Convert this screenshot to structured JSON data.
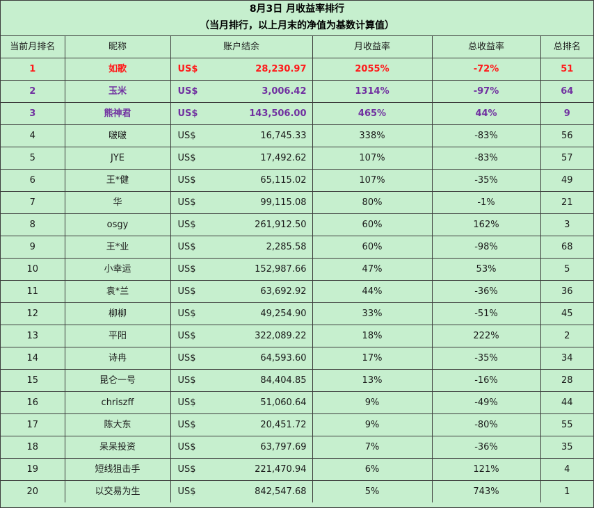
{
  "title": {
    "line1": "8月3日 月收益率排行",
    "line2": "（当月排行，以上月末的净值为基数计算值）"
  },
  "headers": [
    "当前月排名",
    "昵称",
    "账户结余",
    "月收益率",
    "总收益率",
    "总排名"
  ],
  "currency": "US$",
  "rows": [
    {
      "rank": "1",
      "name": "如歌",
      "balance": "28,230.97",
      "monthly": "2055%",
      "total": "-72%",
      "overall": "51"
    },
    {
      "rank": "2",
      "name": "玉米",
      "balance": "3,006.42",
      "monthly": "1314%",
      "total": "-97%",
      "overall": "64"
    },
    {
      "rank": "3",
      "name": "熊神君",
      "balance": "143,506.00",
      "monthly": "465%",
      "total": "44%",
      "overall": "9"
    },
    {
      "rank": "4",
      "name": "啵啵",
      "balance": "16,745.33",
      "monthly": "338%",
      "total": "-83%",
      "overall": "56"
    },
    {
      "rank": "5",
      "name": "JYE",
      "balance": "17,492.62",
      "monthly": "107%",
      "total": "-83%",
      "overall": "57"
    },
    {
      "rank": "6",
      "name": "王*健",
      "balance": "65,115.02",
      "monthly": "107%",
      "total": "-35%",
      "overall": "49"
    },
    {
      "rank": "7",
      "name": "华",
      "balance": "99,115.08",
      "monthly": "80%",
      "total": "-1%",
      "overall": "21"
    },
    {
      "rank": "8",
      "name": "osgy",
      "balance": "261,912.50",
      "monthly": "60%",
      "total": "162%",
      "overall": "3"
    },
    {
      "rank": "9",
      "name": "王*业",
      "balance": "2,285.58",
      "monthly": "60%",
      "total": "-98%",
      "overall": "68"
    },
    {
      "rank": "10",
      "name": "小幸运",
      "balance": "152,987.66",
      "monthly": "47%",
      "total": "53%",
      "overall": "5"
    },
    {
      "rank": "11",
      "name": "袁*兰",
      "balance": "63,692.92",
      "monthly": "44%",
      "total": "-36%",
      "overall": "36"
    },
    {
      "rank": "12",
      "name": "柳柳",
      "balance": "49,254.90",
      "monthly": "33%",
      "total": "-51%",
      "overall": "45"
    },
    {
      "rank": "13",
      "name": "平阳",
      "balance": "322,089.22",
      "monthly": "18%",
      "total": "222%",
      "overall": "2"
    },
    {
      "rank": "14",
      "name": "诗冉",
      "balance": "64,593.60",
      "monthly": "17%",
      "total": "-35%",
      "overall": "34"
    },
    {
      "rank": "15",
      "name": "昆仑一号",
      "balance": "84,404.85",
      "monthly": "13%",
      "total": "-16%",
      "overall": "28"
    },
    {
      "rank": "16",
      "name": "chriszff",
      "balance": "51,060.64",
      "monthly": "9%",
      "total": "-49%",
      "overall": "44"
    },
    {
      "rank": "17",
      "name": "陈大东",
      "balance": "20,451.72",
      "monthly": "9%",
      "total": "-80%",
      "overall": "55"
    },
    {
      "rank": "18",
      "name": "呆呆投资",
      "balance": "63,797.69",
      "monthly": "7%",
      "total": "-36%",
      "overall": "35"
    },
    {
      "rank": "19",
      "name": "短线狙击手",
      "balance": "221,470.94",
      "monthly": "6%",
      "total": "121%",
      "overall": "4"
    },
    {
      "rank": "20",
      "name": "以交易为生",
      "balance": "842,547.68",
      "monthly": "5%",
      "total": "743%",
      "overall": "1"
    }
  ],
  "colors": {
    "background": "#c6efce",
    "grid": "#3c3c3c",
    "first_place": "#ff1a1a",
    "second_third_place": "#7030a0"
  }
}
